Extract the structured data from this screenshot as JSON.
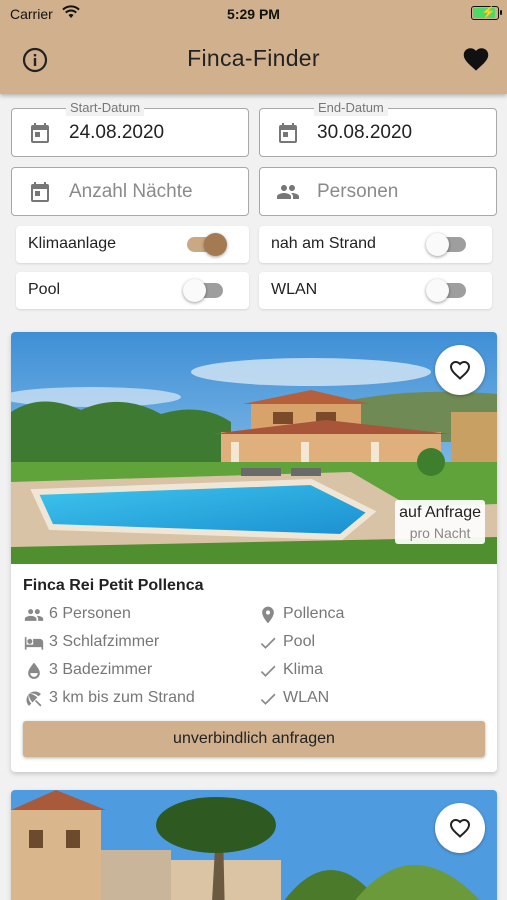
{
  "status_bar": {
    "carrier": "Carrier",
    "time": "5:29 PM"
  },
  "appbar": {
    "title": "Finca-Finder"
  },
  "form": {
    "start": {
      "label": "Start-Datum",
      "value": "24.08.2020"
    },
    "end": {
      "label": "End-Datum",
      "value": "30.08.2020"
    },
    "nights": {
      "placeholder": "Anzahl Nächte"
    },
    "persons": {
      "placeholder": "Personen"
    }
  },
  "filters": [
    {
      "label": "Klimaanlage",
      "on": true
    },
    {
      "label": "nah am Strand",
      "on": false
    },
    {
      "label": "Pool",
      "on": false
    },
    {
      "label": "WLAN",
      "on": false
    }
  ],
  "listings": [
    {
      "title": "Finca Rei Petit Pollenca",
      "price": "auf Anfrage",
      "price_unit": "pro Nacht",
      "features_left": [
        {
          "icon": "people-icon",
          "text": "6 Personen"
        },
        {
          "icon": "bed-icon",
          "text": "3 Schlafzimmer"
        },
        {
          "icon": "water-drop-icon",
          "text": "3 Badezimmer"
        },
        {
          "icon": "beach-umbrella-icon",
          "text": "3 km bis zum Strand"
        }
      ],
      "features_right": [
        {
          "icon": "location-pin-icon",
          "text": "Pollenca"
        },
        {
          "icon": "check-icon",
          "text": "Pool"
        },
        {
          "icon": "check-icon",
          "text": "Klima"
        },
        {
          "icon": "check-icon",
          "text": "WLAN"
        }
      ],
      "cta": "unverbindlich anfragen"
    }
  ],
  "colors": {
    "brand": "#d1b18d",
    "switch_on": "#a47a52"
  }
}
